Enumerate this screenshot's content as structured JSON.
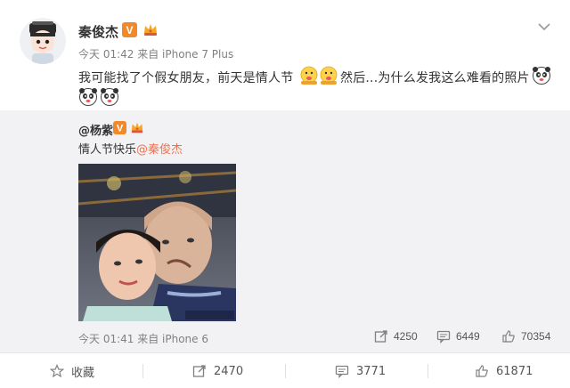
{
  "post": {
    "author": "秦俊杰",
    "meta": "今天 01:42 来自 iPhone 7 Plus",
    "text_part1": "我可能找了个假女朋友，前天是情人节",
    "text_part2": "然后...为什么发我这么难看的照片",
    "verified": "V"
  },
  "repost": {
    "author": "@杨紫",
    "verified": "V",
    "text": "情人节快乐",
    "mention": "@秦俊杰",
    "meta": "今天 01:41 来自 iPhone 6",
    "reposts": "4250",
    "comments": "6449",
    "likes": "70354"
  },
  "actions": {
    "favorite": "收藏",
    "repost": "2470",
    "comment": "3771",
    "like": "61871"
  },
  "colors": {
    "accent": "#eb7350",
    "repost_bg": "#f2f2f5",
    "verified_badge": "#f1892a"
  },
  "icons": [
    "dropdown-caret-icon",
    "verified-badge-icon",
    "vip-crown-icon",
    "lick-emoji-icon",
    "panda-emoji-icon",
    "repost-icon",
    "comment-icon",
    "like-icon",
    "star-icon"
  ]
}
